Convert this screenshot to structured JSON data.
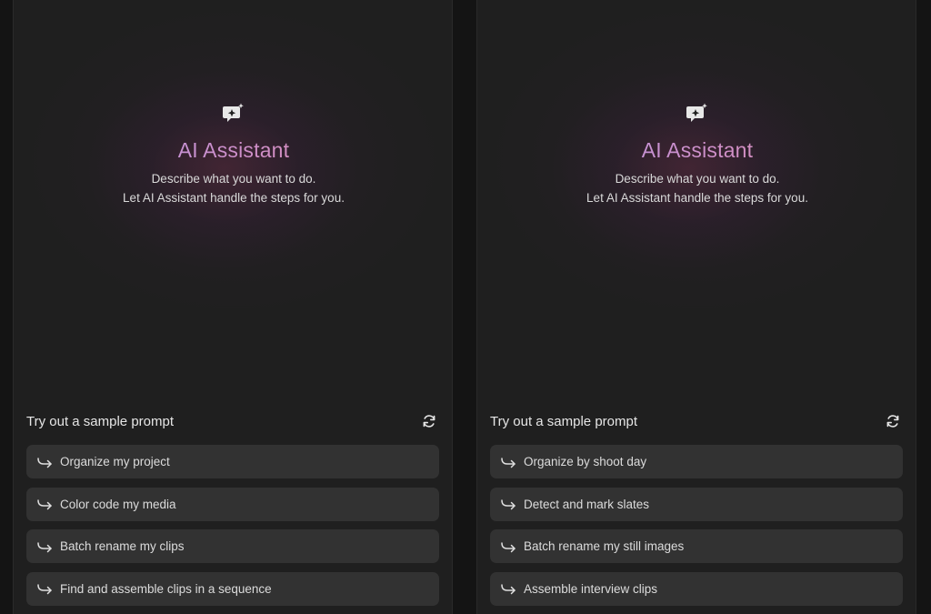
{
  "panels": [
    {
      "icon": "ai-chat-sparkle-icon",
      "title": "AI Assistant",
      "description_lines": [
        "Describe what you want to do.",
        "Let AI Assistant handle the steps for you."
      ],
      "prompts_title": "Try out a sample prompt",
      "refresh_icon": "refresh-icon",
      "prompts": [
        "Organize my project",
        "Color code my media",
        "Batch rename my clips",
        "Find and assemble clips in a sequence"
      ]
    },
    {
      "icon": "ai-chat-sparkle-icon",
      "title": "AI Assistant",
      "description_lines": [
        "Describe what you want to do.",
        "Let AI Assistant handle the steps for you."
      ],
      "prompts_title": "Try out a sample prompt",
      "refresh_icon": "refresh-icon",
      "prompts": [
        "Organize by shoot day",
        "Detect and mark slates",
        "Batch rename my still images",
        "Assemble interview clips"
      ]
    }
  ],
  "colors": {
    "background": "#141414",
    "panel": "#1f1f1f",
    "prompt_button": "#323232",
    "title_gradient_start": "#b596e8",
    "title_gradient_end": "#e48fa7",
    "text": "#dcdcdc"
  },
  "prompt_icon": "arrow-return-right-icon"
}
